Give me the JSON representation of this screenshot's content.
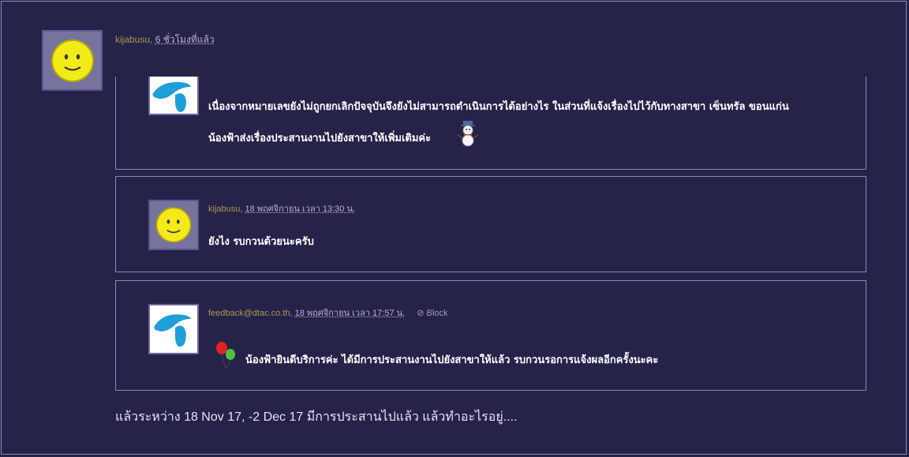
{
  "post": {
    "author": "kijabusu",
    "separator": ",",
    "time": "6 ชั่วโมงที่แล้ว",
    "avatar_icon": "smiley-face-icon",
    "body": "แล้วระหว่าง 18 Nov 17, -2 Dec 17  มีการประสานไปแล้ว แล้วทำอะไรอยู่...."
  },
  "quotes": [
    {
      "avatar_icon": "dtac-logo-icon",
      "line1": "เนื่องจากหมายเลขยังไม่ถูกยกเลิกปัจจุบันจึงยังไม่สามารถดำเนินการได้อย่างไร ในส่วนที่แจ้งเรื่องไปไว้กับทางสาขา เซ็นทรัล ขอนแก่น",
      "line2": "น้องฟ้าส่งเรื่องประสานงานไปยังสาขาให้เพิ่มเติมค่ะ",
      "emoticon": "snowman-icon"
    },
    {
      "author": "kijabusu",
      "separator": ",",
      "time": "18 พฤศจิกายน เวลา 13:30 น.",
      "avatar_icon": "smiley-face-icon",
      "text": "ยังไง รบกวนด้วยนะครับ"
    },
    {
      "author": "feedback@dtac.co.th",
      "separator": ",",
      "time": "18 พฤศจิกายน เวลา 17:57 น.",
      "block_label": "Block",
      "block_icon": "block-icon",
      "avatar_icon": "dtac-logo-icon",
      "emoticon": "balloons-icon",
      "text": "น้องฟ้ายินดีบริการค่ะ  ได้มีการประสานงานไปยังสาขาให้แล้ว  รบกวนรอการแจ้งผลอีกครั้งนะคะ"
    }
  ],
  "colors": {
    "background": "#25234a",
    "author": "#a69a4a",
    "border": "#8c88b6"
  }
}
